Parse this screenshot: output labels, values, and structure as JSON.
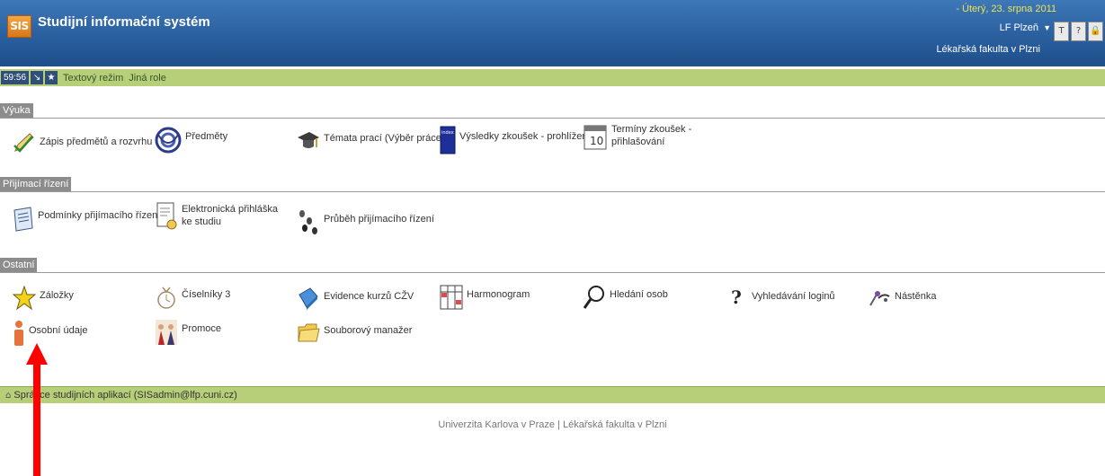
{
  "header": {
    "logo": "SIS",
    "title": "Studijní informační systém",
    "date": "- Úterý, 23. srpna 2011",
    "faculty_short": "LF Plzeň",
    "dropdown_icon": "chevron-down-icon",
    "faculty": "Lékařská fakulta v Plzni",
    "icons": [
      "text-mode-icon",
      "help-icon",
      "lock-icon"
    ]
  },
  "toolbar": {
    "timer": "59:56",
    "text_mode": "Textový režim",
    "other_role": "Jiná role"
  },
  "sections": [
    {
      "label": "Výuka",
      "items": [
        {
          "label": "Zápis předmětů a rozvrhu",
          "icon": "pencil-check-icon"
        },
        {
          "label": "Předměty",
          "icon": "knot-icon"
        },
        {
          "label": "Témata prací (Výběr práce)",
          "icon": "graduation-cap-icon"
        },
        {
          "label": "Výsledky zkoušek - prohlížení",
          "icon": "index-book-icon"
        },
        {
          "label": "Termíny zkoušek - přihlašování",
          "icon": "calendar-icon"
        }
      ]
    },
    {
      "label": "Přijímací řízení",
      "items": [
        {
          "label": "Podmínky přijímacího řízení",
          "icon": "clipboard-icon"
        },
        {
          "label": "Elektronická přihláška ke studiu",
          "icon": "application-form-icon"
        },
        {
          "label": "Průběh přijímacího řízení",
          "icon": "footsteps-icon"
        }
      ]
    },
    {
      "label": "Ostatní",
      "items": [
        {
          "label": "Záložky",
          "icon": "star-icon"
        },
        {
          "label": "Číselníky 3",
          "icon": "numbers-icon"
        },
        {
          "label": "Evidence kurzů CŽV",
          "icon": "book-icon"
        },
        {
          "label": "Harmonogram",
          "icon": "schedule-icon"
        },
        {
          "label": "Hledání osob",
          "icon": "magnifier-icon"
        },
        {
          "label": "Vyhledávání loginů",
          "icon": "question-icon"
        },
        {
          "label": "Nástěnka",
          "icon": "pin-board-icon"
        },
        {
          "label": "Osobní údaje",
          "icon": "person-icon"
        },
        {
          "label": "Promoce",
          "icon": "graduation-ceremony-icon"
        },
        {
          "label": "Souborový manažer",
          "icon": "folder-icon"
        }
      ]
    }
  ],
  "footer": {
    "admin": "Správce studijních aplikací (SISadmin@lfp.cuni.cz)",
    "university": "Univerzita Karlova v Praze | Lékařská fakulta v Plzni"
  },
  "colors": {
    "header": "#2a5f9e",
    "toolbar": "#b8cf7a",
    "section_label": "#8c8c8c",
    "date_text": "#f0e34a",
    "annotation_arrow": "#ff0000"
  }
}
